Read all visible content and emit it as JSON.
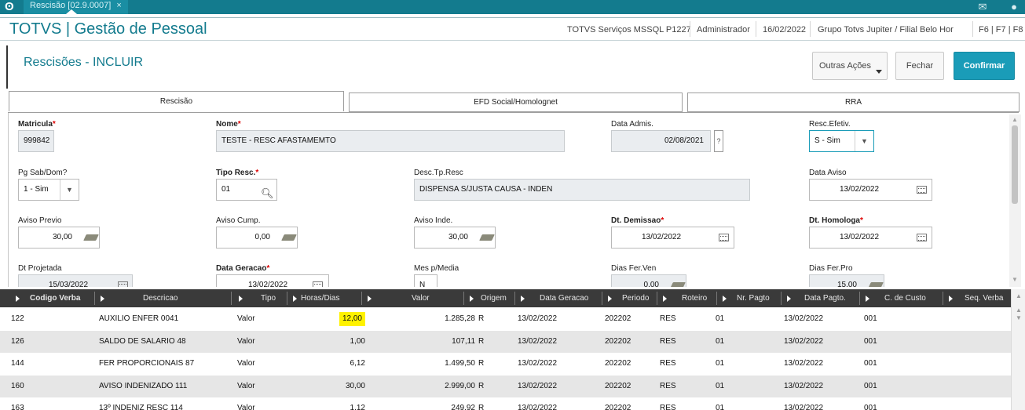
{
  "topbar": {
    "tab_label": "Rescisão [02.9.0007]",
    "tab_close": "×"
  },
  "header": {
    "app_title": "TOTVS | Gestão de Pessoal",
    "server": "TOTVS Serviços MSSQL P1227",
    "user": "Administrador",
    "date": "16/02/2022",
    "company": "Grupo Totvs Jupiter / Filial Belo Hor",
    "shortcuts": "F6 | F7 | F8"
  },
  "page": {
    "title": "Rescisões - INCLUIR",
    "actions_label": "Outras Ações",
    "close_label": "Fechar",
    "confirm_label": "Confirmar"
  },
  "tabs": [
    {
      "label": "Rescisão"
    },
    {
      "label": "EFD Social/Homolognet"
    },
    {
      "label": "RRA"
    }
  ],
  "form": {
    "matricula": {
      "label": "Matricula",
      "value": "999842"
    },
    "nome": {
      "label": "Nome",
      "value": "TESTE - RESC AFASTAMEMTO"
    },
    "data_admis": {
      "label": "Data Admis.",
      "value": "02/08/2021",
      "help": "?"
    },
    "resc_efetiv": {
      "label": "Resc.Efetiv.",
      "value": "S - Sim"
    },
    "pg_sab_dom": {
      "label": "Pg Sab/Dom?",
      "value": "1 - Sim"
    },
    "tipo_resc": {
      "label": "Tipo Resc.",
      "value": "01"
    },
    "desc_tp_resc": {
      "label": "Desc.Tp.Resc",
      "value": "DISPENSA S/JUSTA CAUSA - INDEN"
    },
    "data_aviso": {
      "label": "Data Aviso",
      "value": "13/02/2022"
    },
    "aviso_previo": {
      "label": "Aviso Previo",
      "value": "30,00"
    },
    "aviso_cump": {
      "label": "Aviso Cump.",
      "value": "0,00"
    },
    "aviso_inde": {
      "label": "Aviso Inde.",
      "value": "30,00"
    },
    "dt_demissao": {
      "label": "Dt. Demissao",
      "value": "13/02/2022"
    },
    "dt_homologa": {
      "label": "Dt. Homologa",
      "value": "13/02/2022"
    },
    "dt_projetada": {
      "label": "Dt Projetada",
      "value": "15/03/2022"
    },
    "data_geracao": {
      "label": "Data Geracao",
      "value": "13/02/2022"
    },
    "mes_media": {
      "label": "Mes p/Media",
      "value": "N"
    },
    "dias_fer_ven": {
      "label": "Dias Fer.Ven",
      "value": "0,00"
    },
    "dias_fer_pro": {
      "label": "Dias Fer.Pro",
      "value": "15,00"
    },
    "required_mark": "*"
  },
  "grid": {
    "columns": [
      "Codigo Verba",
      "Descricao",
      "Tipo",
      "Horas/Dias",
      "Valor",
      "Origem",
      "Data Geracao",
      "Periodo",
      "Roteiro",
      "Nr. Pagto",
      "Data Pagto.",
      "C. de Custo",
      "Seq. Verba"
    ],
    "rows": [
      {
        "codigo": "122",
        "descricao": "AUXILIO ENFER 0041",
        "tipo": "Valor",
        "horas": "12,00",
        "valor": "1.285,28",
        "origem": "R",
        "data_geracao": "13/02/2022",
        "periodo": "202202",
        "roteiro": "RES",
        "nr_pagto": "01",
        "data_pagto": "13/02/2022",
        "ccusto": "001"
      },
      {
        "codigo": "126",
        "descricao": "SALDO DE SALARIO 48",
        "tipo": "Valor",
        "horas": "1,00",
        "valor": "107,11",
        "origem": "R",
        "data_geracao": "13/02/2022",
        "periodo": "202202",
        "roteiro": "RES",
        "nr_pagto": "01",
        "data_pagto": "13/02/2022",
        "ccusto": "001"
      },
      {
        "codigo": "144",
        "descricao": "FER PROPORCIONAIS 87",
        "tipo": "Valor",
        "horas": "6,12",
        "valor": "1.499,50",
        "origem": "R",
        "data_geracao": "13/02/2022",
        "periodo": "202202",
        "roteiro": "RES",
        "nr_pagto": "01",
        "data_pagto": "13/02/2022",
        "ccusto": "001"
      },
      {
        "codigo": "160",
        "descricao": "AVISO INDENIZADO 111",
        "tipo": "Valor",
        "horas": "30,00",
        "valor": "2.999,00",
        "origem": "R",
        "data_geracao": "13/02/2022",
        "periodo": "202202",
        "roteiro": "RES",
        "nr_pagto": "01",
        "data_pagto": "13/02/2022",
        "ccusto": "001"
      },
      {
        "codigo": "163",
        "descricao": "13º INDENIZ RESC 114",
        "tipo": "Valor",
        "horas": "1,12",
        "valor": "249,92",
        "origem": "R",
        "data_geracao": "13/02/2022",
        "periodo": "202202",
        "roteiro": "RES",
        "nr_pagto": "01",
        "data_pagto": "13/02/2022",
        "ccusto": "001"
      }
    ]
  },
  "colors": {
    "brand": "#137b8e",
    "primary_button": "#1a9cb8",
    "highlight": "#fff200",
    "grid_header": "#3a3a3a"
  }
}
